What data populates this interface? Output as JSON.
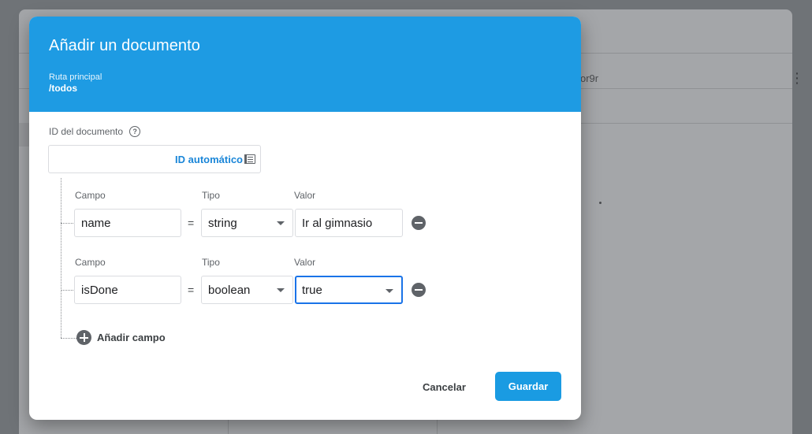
{
  "background": {
    "document_id_partial": "or9r",
    "menu_glyph": "⋮"
  },
  "dialog": {
    "title": "Añadir un documento",
    "path_label": "Ruta principal",
    "path_value": "/todos",
    "doc_id_label": "ID del documento",
    "help_glyph": "?",
    "auto_id_label": "ID automático",
    "fields": [
      {
        "field_label": "Campo",
        "type_label": "Tipo",
        "value_label": "Valor",
        "field_value": "name",
        "equals": "=",
        "type_value": "string",
        "value_value": "Ir al gimnasio",
        "value_is_select": false
      },
      {
        "field_label": "Campo",
        "type_label": "Tipo",
        "value_label": "Valor",
        "field_value": "isDone",
        "equals": "=",
        "type_value": "boolean",
        "value_value": "true",
        "value_is_select": true
      }
    ],
    "add_field_label": "Añadir campo",
    "cancel_label": "Cancelar",
    "save_label": "Guardar"
  },
  "colors": {
    "header_blue": "#1e9be3",
    "primary_button": "#1a9be2",
    "focus_border": "#1a73e8"
  }
}
